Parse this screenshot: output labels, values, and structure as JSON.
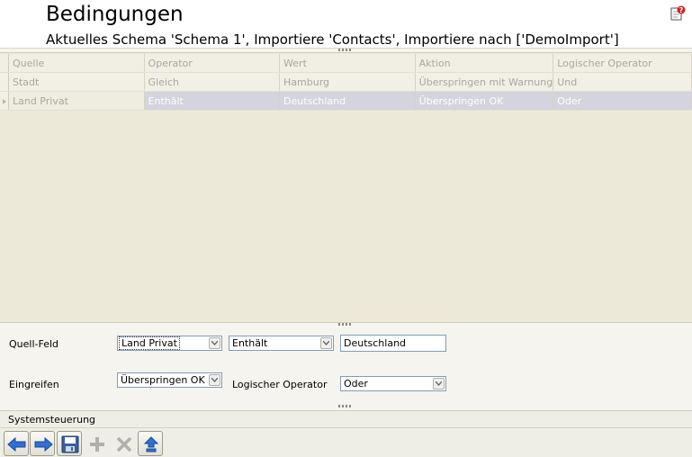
{
  "header": {
    "title": "Bedingungen",
    "subtitle": "Aktuelles Schema 'Schema 1', Importiere 'Contacts', Importiere nach ['DemoImport']",
    "help_icon": "help-icon"
  },
  "grid": {
    "columns": [
      "Quelle",
      "Operator",
      "Wert",
      "Aktion",
      "Logischer Operator"
    ],
    "rows": [
      [
        "Stadt",
        "Gleich",
        "Hamburg",
        "Überspringen mit Warnung",
        "Und"
      ],
      [
        "Land Privat",
        "Enthält",
        "Deutschland",
        "Überspringen OK",
        "Oder"
      ]
    ],
    "selected_row": 1
  },
  "form": {
    "source_field_label": "Quell-Feld",
    "source_field_value": "Land Privat",
    "operator_value": "Enthält",
    "value_text": "Deutschland",
    "action_label": "Eingreifen",
    "action_value": "Überspringen OK",
    "logical_operator_label": "Logischer Operator",
    "logical_operator_value": "Oder"
  },
  "system": {
    "title": "Systemsteuerung",
    "buttons": [
      {
        "icon": "arrow-left-icon",
        "enabled": true
      },
      {
        "icon": "arrow-right-icon",
        "enabled": true
      },
      {
        "icon": "save-icon",
        "enabled": true
      },
      {
        "icon": "plus-icon",
        "enabled": false
      },
      {
        "icon": "delete-icon",
        "enabled": false
      },
      {
        "icon": "upload-icon",
        "enabled": true
      }
    ]
  },
  "colors": {
    "accent_blue": "#2f6fd6",
    "selected_row": "#d4d3de"
  }
}
